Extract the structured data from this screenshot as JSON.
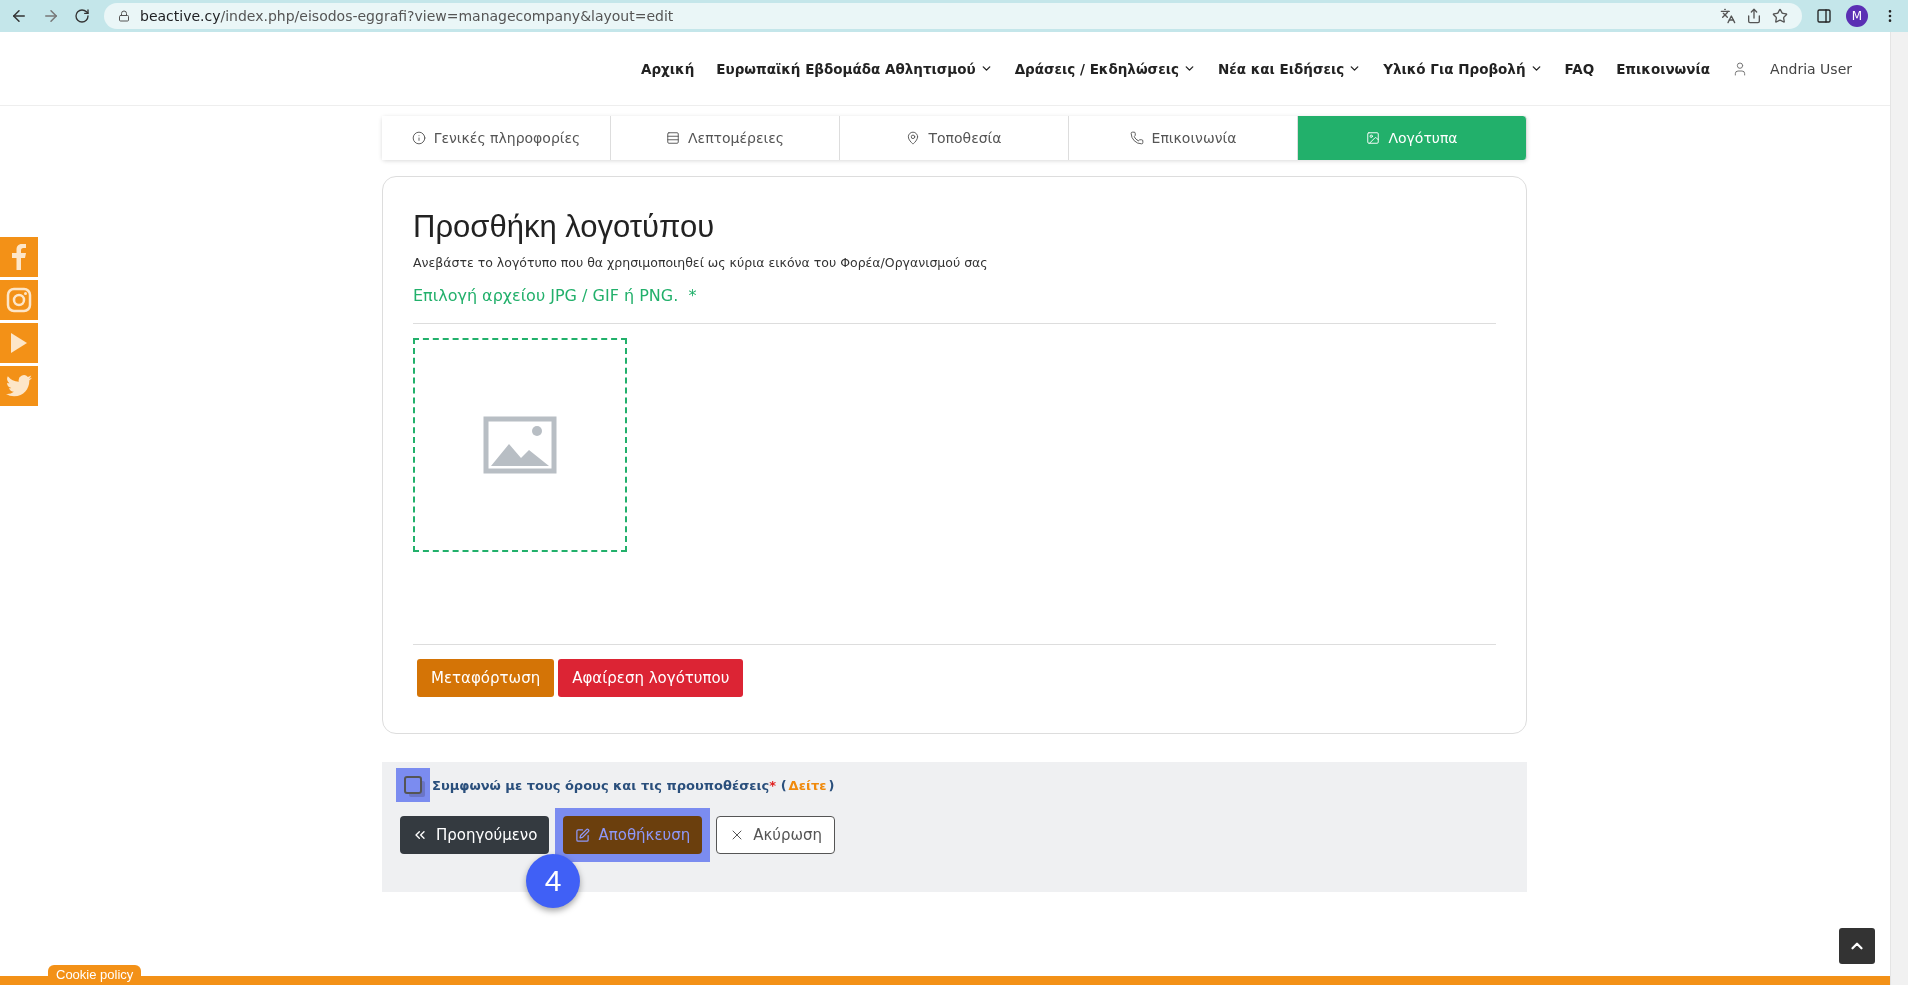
{
  "browser": {
    "url_host": "beactive.cy",
    "url_path": "/index.php/eisodos-eggrafi?view=managecompany&layout=edit",
    "avatar": "M"
  },
  "nav": {
    "items": [
      {
        "label": "Αρχική",
        "dropdown": false
      },
      {
        "label": "Ευρωπαϊκή Εβδομάδα Αθλητισμού",
        "dropdown": true
      },
      {
        "label": "Δράσεις / Εκδηλώσεις",
        "dropdown": true
      },
      {
        "label": "Νέα και Ειδήσεις",
        "dropdown": true
      },
      {
        "label": "Υλικό Για Προβολή",
        "dropdown": true
      },
      {
        "label": "FAQ",
        "dropdown": false
      },
      {
        "label": "Επικοινωνία",
        "dropdown": false
      }
    ],
    "user": "Andria User"
  },
  "social": [
    {
      "kind": "facebook"
    },
    {
      "kind": "instagram"
    },
    {
      "kind": "youtube"
    },
    {
      "kind": "twitter"
    }
  ],
  "tabs": [
    {
      "label": "Γενικές πληροφορίες",
      "selected": false
    },
    {
      "label": "Λεπτομέρειες",
      "selected": false
    },
    {
      "label": "Τοποθεσία",
      "selected": false
    },
    {
      "label": "Επικοινωνία",
      "selected": false
    },
    {
      "label": "Λογότυπα",
      "selected": true
    }
  ],
  "card": {
    "title": "Προσθήκη λογοτύπου",
    "description": "Ανεβάστε το λογότυπο που θα χρησιμοποιηθεί ως κύρια εικόνα του Φορέα/Οργανισμού σας",
    "file_label": "Επιλογή αρχείου JPG / GIF ή PNG.",
    "required_mark": "*",
    "buttons": [
      {
        "label": "Μεταφόρτωση",
        "kind": "upload"
      },
      {
        "label": "Αφαίρεση λογότυπου",
        "kind": "remove"
      }
    ]
  },
  "terms": {
    "checked": false,
    "highlighted": true,
    "text": "Συμφωνώ με τους όρους και τις προυποθέσεις",
    "required_mark": "*",
    "link_open": "(",
    "link": "Δείτε",
    "link_close": ")"
  },
  "actions": [
    {
      "label": "Προηγούμενο",
      "kind": "previous",
      "highlighted": false
    },
    {
      "label": "Αποθήκευση",
      "kind": "save",
      "highlighted": true
    },
    {
      "label": "Ακύρωση",
      "kind": "cancel",
      "highlighted": false
    }
  ],
  "annotation": {
    "step": "4"
  },
  "cookie": {
    "label": "Cookie policy"
  }
}
